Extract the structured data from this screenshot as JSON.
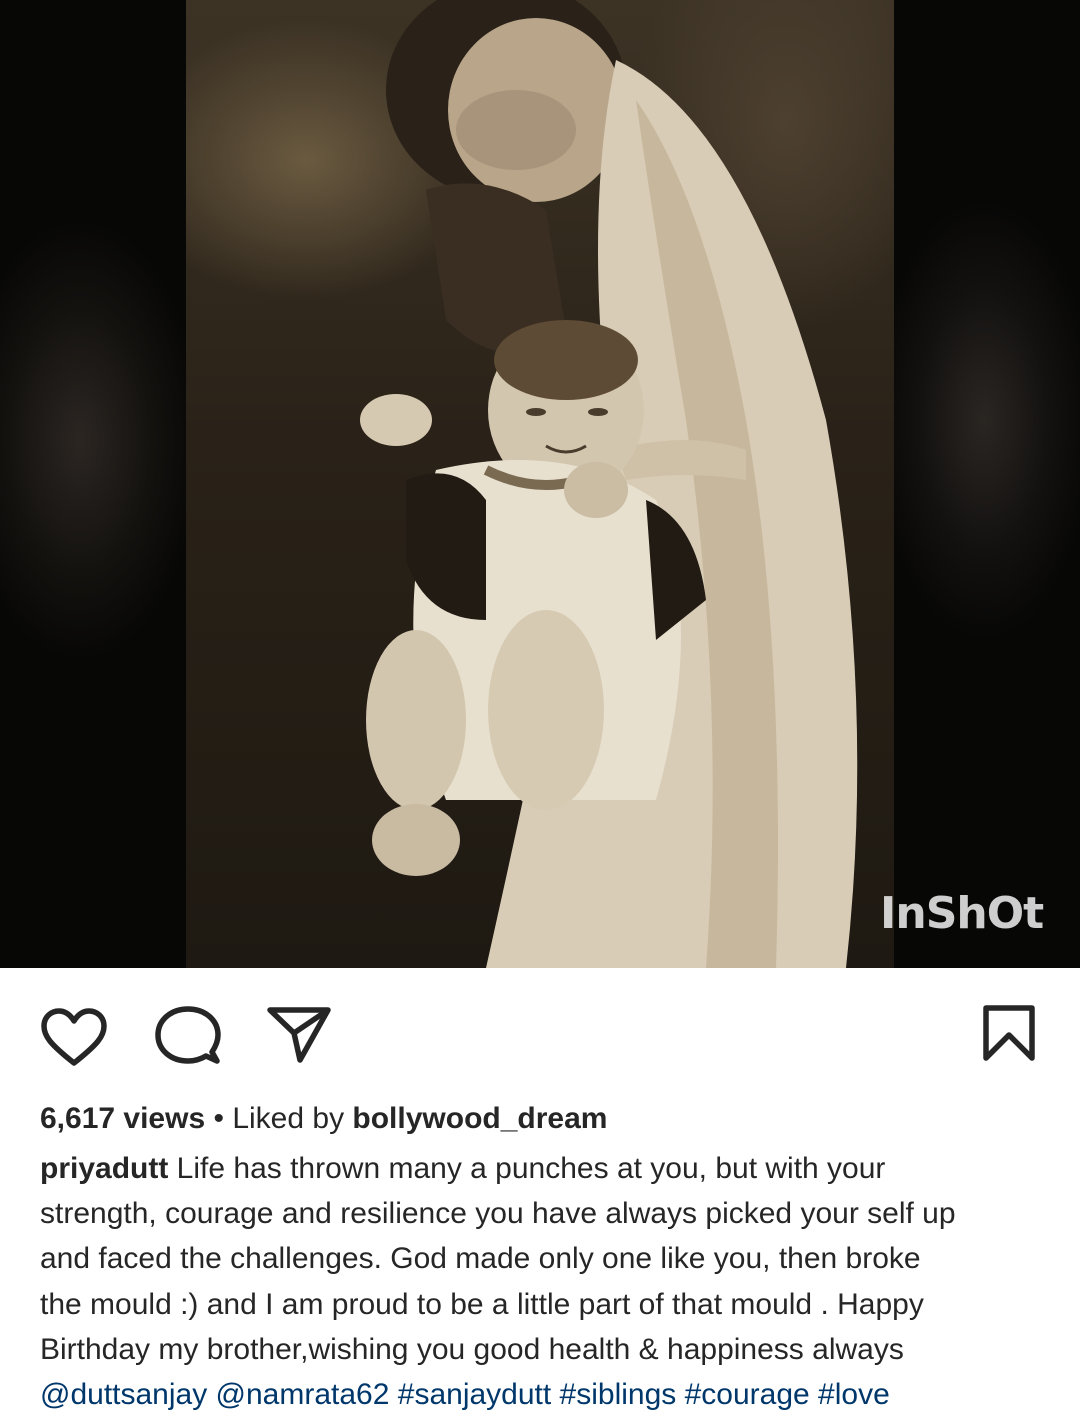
{
  "media": {
    "watermark": "InShOt"
  },
  "actions": {
    "like_icon": "heart-icon",
    "comment_icon": "comment-icon",
    "share_icon": "paper-plane-icon",
    "save_icon": "bookmark-icon"
  },
  "post": {
    "views": "6,617 views",
    "separator": " • ",
    "liked_by_prefix": "Liked by ",
    "liked_by_user": "bollywood_dream",
    "author": "priyadutt",
    "caption_line1": " Life has thrown many a punches at you, but with your",
    "caption_line2": "strength, courage and resilience you have always picked your self up",
    "caption_line3": "and faced the challenges. God made only one like you, then broke",
    "caption_line4": "the mould :) and I am proud to be a little part of that mould . Happy",
    "caption_line5": "Birthday my brother,wishing you  good health & happiness always",
    "tags_line": "@duttsanjay @namrata62  #sanjaydutt #siblings #courage #love"
  },
  "colors": {
    "text": "#262626",
    "link": "#00376b",
    "media_bg": "#080807"
  }
}
